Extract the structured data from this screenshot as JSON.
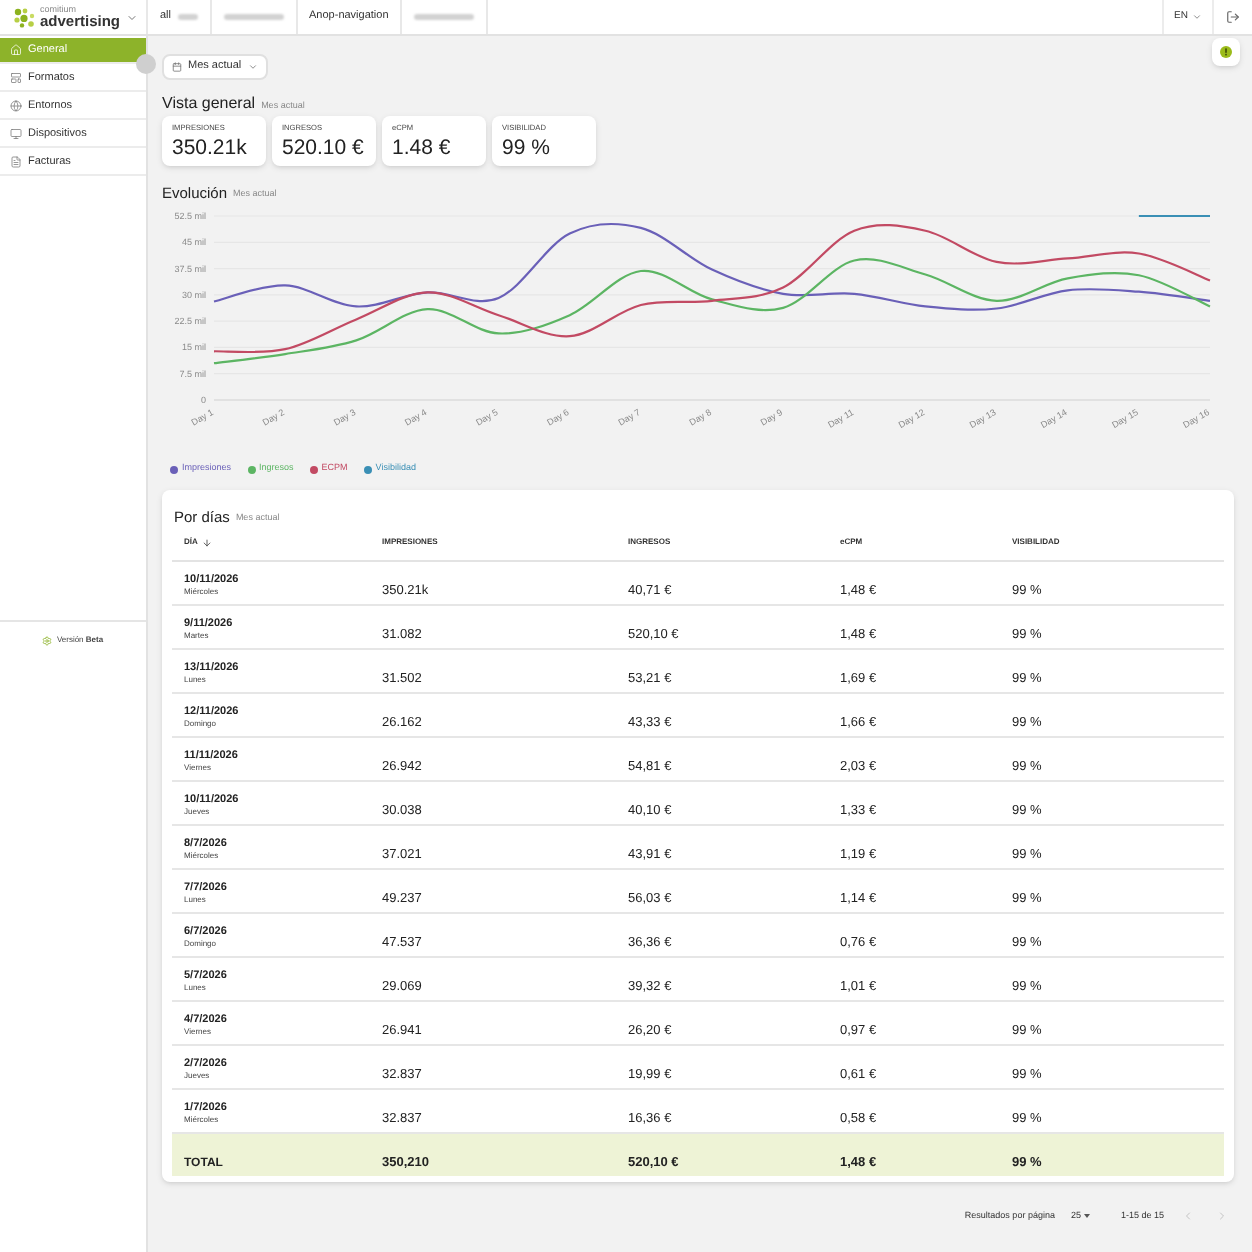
{
  "header": {
    "logo": {
      "top": "comitium",
      "bottom": "advertising"
    },
    "tabs": [
      {
        "label": "all",
        "blurred": true
      },
      {
        "blurred": true
      },
      {
        "label": "Anop-navigation",
        "blurred": false
      },
      {
        "blurred": true
      }
    ],
    "language": "EN"
  },
  "sidebar": {
    "items": [
      {
        "label": "General",
        "selected": true
      },
      {
        "label": "Formatos",
        "selected": false
      },
      {
        "label": "Entornos",
        "selected": false
      },
      {
        "label": "Dispositivos",
        "selected": false
      },
      {
        "label": "Facturas",
        "selected": false
      }
    ],
    "footer": "Versión **Beta**"
  },
  "period_select": "Mes actual",
  "overview": {
    "title": "Vista general",
    "subtitle": "Mes actual",
    "cards": [
      {
        "label": "IMPRESIONES",
        "value": "350.21k"
      },
      {
        "label": "INGRESOS",
        "value": "520.10 €"
      },
      {
        "label": "eCPM",
        "value": "1.48 €"
      },
      {
        "label": "VISIBILIDAD",
        "value": "99 %"
      }
    ]
  },
  "evolution": {
    "title": "Evolución",
    "subtitle": "Mes actual",
    "chart_data": {
      "type": "line",
      "grid": true,
      "x": [
        "Day 1",
        "Day 2",
        "Day 3",
        "Day 4",
        "Day 5",
        "Day 6",
        "Day 7",
        "Day 8",
        "Day 9",
        "Day 11",
        "Day 12",
        "Day 13",
        "Day 14",
        "Day 15",
        "Day 16"
      ],
      "ylim": [
        0,
        52.5
      ],
      "yticks": [
        0,
        {
          "value": 7.5,
          "label": "7.5 mil"
        },
        {
          "value": 15,
          "label": "15 mil"
        },
        {
          "value": 22.5,
          "label": "22.5 mil"
        },
        {
          "value": 30,
          "label": "30 mil"
        },
        {
          "value": 37.5,
          "label": "37.5 mil"
        },
        {
          "value": 45,
          "label": "45 mil"
        },
        {
          "value": 52.5,
          "label": "52.5 mil"
        }
      ],
      "series": [
        {
          "name": "Impresiones",
          "color": "#6a60b8",
          "values": [
            28.1,
            32.7,
            26.7,
            30.7,
            29.1,
            47.5,
            49.1,
            37.2,
            30.3,
            30.3,
            26.7,
            26.1,
            31.3,
            30.9,
            28.3
          ]
        },
        {
          "name": "Ingresos",
          "color": "#5cb563",
          "values": [
            10.5,
            13.1,
            17,
            25.9,
            19,
            24.2,
            36.8,
            28.7,
            26.3,
            39.8,
            35.8,
            28.3,
            34.7,
            35.6,
            26.7
          ]
        },
        {
          "name": "ECPM",
          "color": "#c24a63",
          "values": [
            13.9,
            14.5,
            23,
            30.7,
            24.2,
            18.2,
            27.1,
            28.3,
            32.1,
            48.3,
            48.3,
            39.4,
            40.4,
            41.8,
            34.1
          ]
        },
        {
          "name": "Visibilidad",
          "color": "#3a8fb5",
          "values": [
            null,
            null,
            null,
            null,
            null,
            null,
            null,
            null,
            null,
            null,
            null,
            null,
            null,
            52.5,
            52.5
          ]
        }
      ]
    }
  },
  "table": {
    "title": "Por días",
    "subtitle": "Mes actual",
    "columns": [
      {
        "label": "DÍA",
        "sorted": true
      },
      {
        "label": "IMPRESIONES",
        "sorted": false
      },
      {
        "label": "INGRESOS",
        "sorted": false
      },
      {
        "label": "eCPM",
        "sorted": false
      },
      {
        "label": "VISIBILIDAD",
        "sorted": false
      }
    ],
    "rows": [
      {
        "cells": [
          "10/11/2026",
          "350.21k",
          "40,71 €",
          "1,48 €",
          "99 %"
        ],
        "weekday": "Miércoles"
      },
      {
        "cells": [
          "9/11/2026",
          "31.082",
          "520,10 €",
          "1,48 €",
          "99 %"
        ],
        "weekday": "Martes"
      },
      {
        "cells": [
          "13/11/2026",
          "31.502",
          "53,21 €",
          "1,69 €",
          "99 %"
        ],
        "weekday": "Lunes"
      },
      {
        "cells": [
          "12/11/2026",
          "26.162",
          "43,33 €",
          "1,66 €",
          "99 %"
        ],
        "weekday": "Domingo"
      },
      {
        "cells": [
          "11/11/2026",
          "26.942",
          "54,81 €",
          "2,03 €",
          "99 %"
        ],
        "weekday": "Viernes"
      },
      {
        "cells": [
          "10/11/2026",
          "30.038",
          "40,10 €",
          "1,33 €",
          "99 %"
        ],
        "weekday": "Jueves"
      },
      {
        "cells": [
          "8/7/2026",
          "37.021",
          "43,91 €",
          "1,19 €",
          "99 %"
        ],
        "weekday": "Miércoles"
      },
      {
        "cells": [
          "7/7/2026",
          "49.237",
          "56,03 €",
          "1,14 €",
          "99 %"
        ],
        "weekday": "Lunes"
      },
      {
        "cells": [
          "6/7/2026",
          "47.537",
          "36,36 €",
          "0,76 €",
          "99 %"
        ],
        "weekday": "Domingo"
      },
      {
        "cells": [
          "5/7/2026",
          "29.069",
          "39,32 €",
          "1,01 €",
          "99 %"
        ],
        "weekday": "Lunes"
      },
      {
        "cells": [
          "4/7/2026",
          "26.941",
          "26,20 €",
          "0,97 €",
          "99 %"
        ],
        "weekday": "Viernes"
      },
      {
        "cells": [
          "2/7/2026",
          "32.837",
          "19,99 €",
          "0,61 €",
          "99 %"
        ],
        "weekday": "Jueves"
      },
      {
        "cells": [
          "1/7/2026",
          "32.837",
          "16,36 €",
          "0,58 €",
          "99 %"
        ],
        "weekday": "Miércoles"
      }
    ],
    "total": {
      "cells": [
        "TOTAL",
        "350,210",
        "520,10 €",
        "1,48 €",
        "99 %"
      ]
    }
  },
  "pagination": {
    "label": "Resultados por página",
    "per_page": "25",
    "range": "1-15 de 15",
    "prev_disabled": true,
    "next_disabled": true
  }
}
